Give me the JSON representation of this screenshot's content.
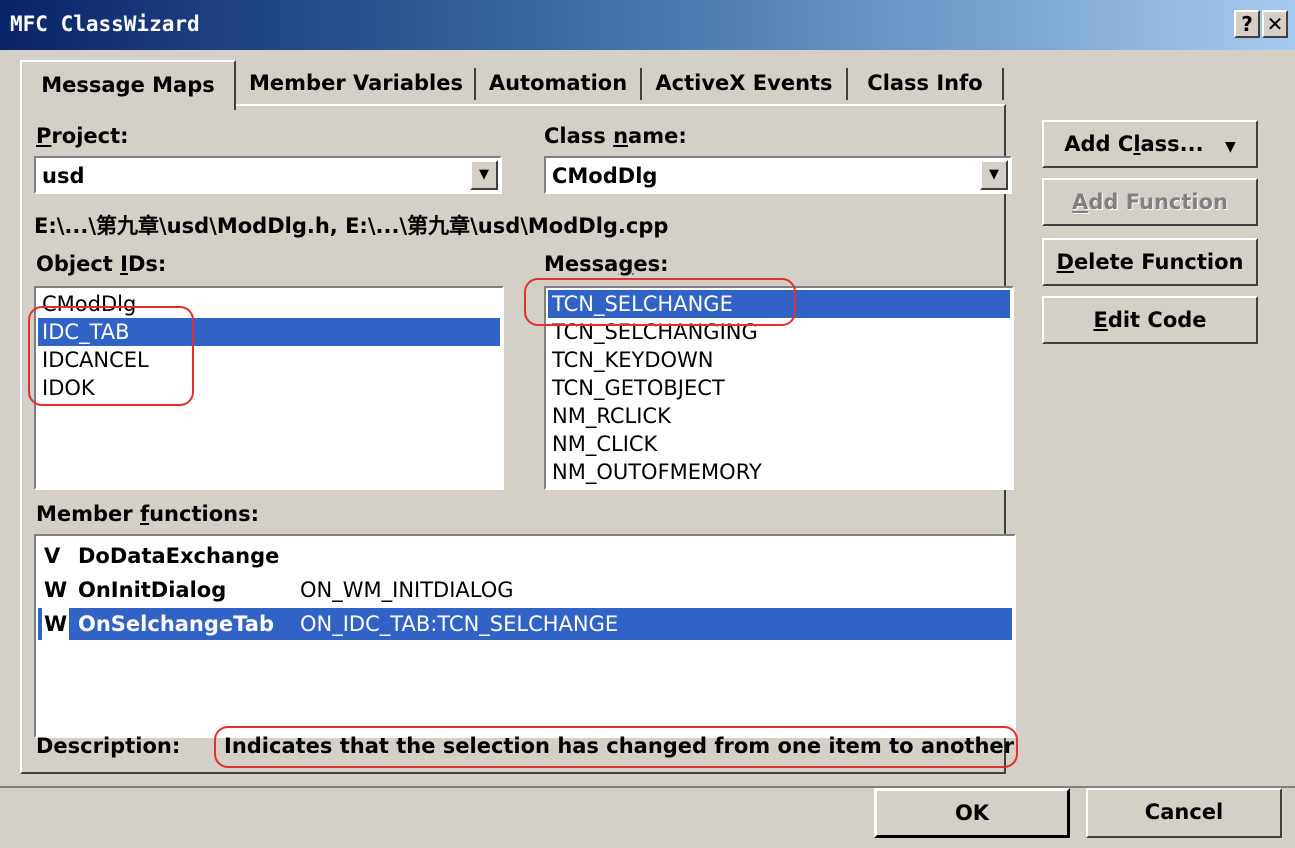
{
  "window": {
    "title": "MFC ClassWizard",
    "help_label": "?",
    "close_label": "✕"
  },
  "tabs": [
    {
      "label": "Message Maps",
      "active": true
    },
    {
      "label": "Member Variables"
    },
    {
      "label": "Automation"
    },
    {
      "label": "ActiveX Events"
    },
    {
      "label": "Class Info"
    }
  ],
  "project": {
    "label_pre": "",
    "label_u": "P",
    "label_post": "roject:",
    "value": "usd"
  },
  "class_name": {
    "label_pre": "Class ",
    "label_u": "n",
    "label_post": "ame:",
    "value": "CModDlg"
  },
  "file_path": "E:\\...\\第九章\\usd\\ModDlg.h, E:\\...\\第九章\\usd\\ModDlg.cpp",
  "object_ids": {
    "label_pre": "Object ",
    "label_u": "I",
    "label_post": "Ds:",
    "items": [
      "CModDlg",
      "IDC_TAB",
      "IDCANCEL",
      "IDOK"
    ],
    "selected_index": 1
  },
  "messages": {
    "label_pre": "Messa",
    "label_u": "g",
    "label_post": "es:",
    "items": [
      "TCN_SELCHANGE",
      "TCN_SELCHANGING",
      "TCN_KEYDOWN",
      "TCN_GETOBJECT",
      "NM_RCLICK",
      "NM_CLICK",
      "NM_OUTOFMEMORY"
    ],
    "selected_index": 0
  },
  "member_functions": {
    "label_pre": "Member ",
    "label_u": "f",
    "label_post": "unctions:",
    "rows": [
      {
        "kind": "V",
        "name": "DoDataExchange",
        "map": ""
      },
      {
        "kind": "W",
        "name": "OnInitDialog",
        "map": "ON_WM_INITDIALOG"
      },
      {
        "kind": "W",
        "name": "OnSelchangeTab",
        "map": "ON_IDC_TAB:TCN_SELCHANGE"
      }
    ],
    "selected_index": 2
  },
  "description": {
    "label": "Description:",
    "text": "Indicates that the selection has changed from one item to another"
  },
  "buttons": {
    "add_class": {
      "pre": "Add C",
      "u": "l",
      "post": "ass...",
      "arrow": "▼"
    },
    "add_function": {
      "pre": "",
      "u": "A",
      "post": "dd Function"
    },
    "delete_function": {
      "pre": "",
      "u": "D",
      "post": "elete Function"
    },
    "edit_code": {
      "pre": "",
      "u": "E",
      "post": "dit Code"
    },
    "ok": "OK",
    "cancel": "Cancel"
  },
  "colors": {
    "dialog_bg": "#d4d0c8",
    "selection": "#3163c6",
    "title_start": "#0a246a",
    "annotation": "#e03030"
  }
}
